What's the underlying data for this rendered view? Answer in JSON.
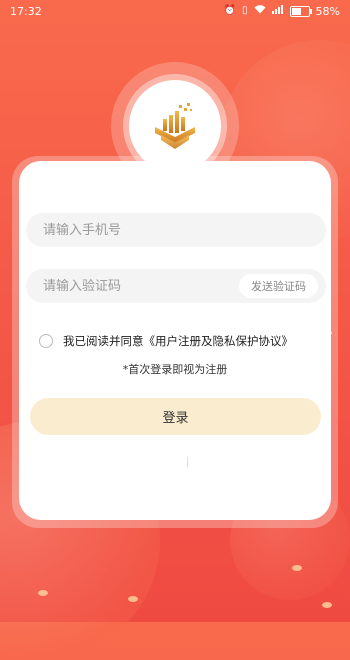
{
  "status_bar": {
    "time": "17:32",
    "icons": [
      "alarm-icon",
      "vibrate-icon",
      "wifi-icon",
      "signal-icon",
      "battery-icon"
    ],
    "battery_percent": "58%",
    "battery_level": 0.58,
    "network_label": "4G"
  },
  "logo": {
    "icon": "golden-tower-logo"
  },
  "form": {
    "phone_placeholder": "请输入手机号",
    "code_placeholder": "请输入验证码",
    "send_code_label": "发送验证码",
    "agreement_prefix": "我已阅读并同意",
    "agreement_link": "《用户注册及隐私保护协议》",
    "agreement_checked": false,
    "hint": "*首次登录即视为注册",
    "login_label": "登录"
  },
  "colors": {
    "background_top": "#f96a4c",
    "background_bottom": "#ef4a42",
    "login_button": "#faecce",
    "logo_gold": "#d9952e"
  }
}
